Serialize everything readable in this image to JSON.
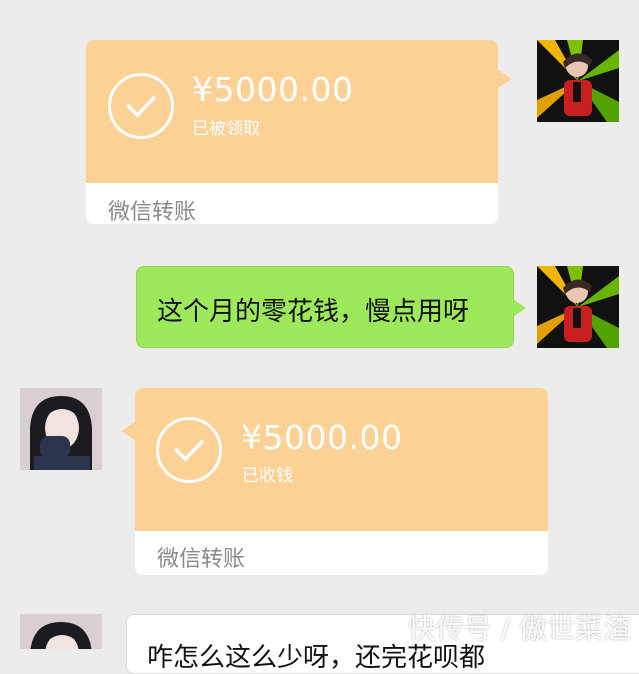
{
  "messages": {
    "transfer_sent": {
      "amount": "¥5000.00",
      "status": "已被领取",
      "footer": "微信转账",
      "icon": "check-circle-icon"
    },
    "text_sent": {
      "text": "这个月的零花钱，慢点用呀"
    },
    "transfer_received": {
      "amount": "¥5000.00",
      "status": "已收钱",
      "footer": "微信转账",
      "icon": "check-circle-icon"
    },
    "text_received_partial": {
      "text": "咋怎么这么少呀，还完花呗都"
    }
  },
  "watermark": {
    "text": "快传号 / 傲世菜渣"
  },
  "colors": {
    "background": "#ececec",
    "transfer_orange": "#fcd196",
    "bubble_green": "#9ee85b",
    "bubble_white": "#ffffff"
  }
}
